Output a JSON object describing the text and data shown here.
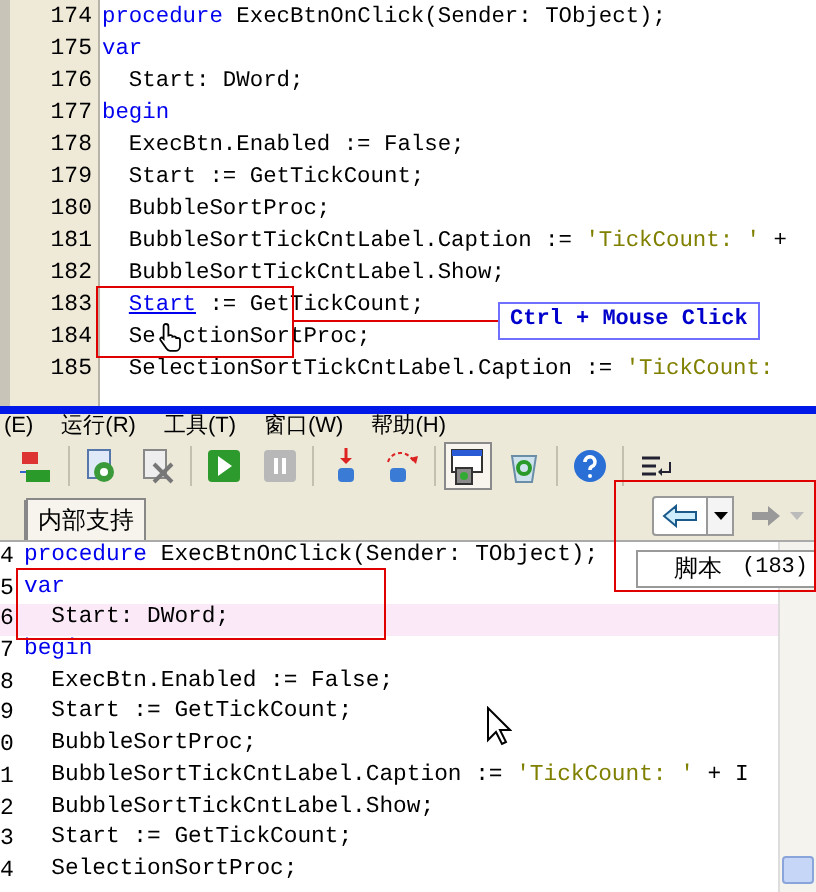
{
  "top_editor": {
    "lines": [
      {
        "number": "174",
        "highlighted": false,
        "tokens": [
          {
            "kind": "keyword",
            "text": "procedure"
          },
          {
            "kind": "plain",
            "text": " ExecBtnOnClick(Sender: TObject);"
          }
        ]
      },
      {
        "number": "175",
        "highlighted": false,
        "tokens": [
          {
            "kind": "keyword",
            "text": "var"
          }
        ]
      },
      {
        "number": "176",
        "highlighted": false,
        "tokens": [
          {
            "kind": "plain",
            "text": "  Start: DWord;"
          }
        ]
      },
      {
        "number": "177",
        "highlighted": false,
        "tokens": [
          {
            "kind": "keyword",
            "text": "begin"
          }
        ]
      },
      {
        "number": "178",
        "highlighted": false,
        "tokens": [
          {
            "kind": "plain",
            "text": "  ExecBtn.Enabled := False;"
          }
        ]
      },
      {
        "number": "179",
        "highlighted": false,
        "tokens": [
          {
            "kind": "plain",
            "text": "  Start := GetTickCount;"
          }
        ]
      },
      {
        "number": "180",
        "highlighted": false,
        "tokens": [
          {
            "kind": "plain",
            "text": "  BubbleSortProc;"
          }
        ]
      },
      {
        "number": "181",
        "highlighted": false,
        "tokens": [
          {
            "kind": "plain",
            "text": "  BubbleSortTickCntLabel.Caption := "
          },
          {
            "kind": "string",
            "text": "'TickCount: '"
          },
          {
            "kind": "plain",
            "text": " +"
          }
        ]
      },
      {
        "number": "182",
        "highlighted": false,
        "tokens": [
          {
            "kind": "plain",
            "text": "  BubbleSortTickCntLabel.Show;"
          }
        ]
      },
      {
        "number": "183",
        "highlighted": false,
        "tokens": [
          {
            "kind": "link",
            "text": "Start"
          },
          {
            "kind": "plain",
            "text": " := GetTickCount;"
          }
        ]
      },
      {
        "number": "184",
        "highlighted": false,
        "tokens": [
          {
            "kind": "plain",
            "text": "  Se"
          },
          {
            "kind": "cursor"
          },
          {
            "kind": "plain",
            "text": "ctionSortProc;"
          }
        ]
      },
      {
        "number": "185",
        "highlighted": false,
        "tokens": [
          {
            "kind": "plain",
            "text": "  SelectionSortTickCntLabel.Caption := "
          },
          {
            "kind": "string",
            "text": "'TickCount:"
          }
        ]
      }
    ],
    "callout": "Ctrl + Mouse Click"
  },
  "menu_bar": [
    "(E)",
    "运行(R)",
    "工具(T)",
    "窗口(W)",
    "帮助(H)"
  ],
  "toolbar": [
    {
      "kind": "replace",
      "pressed": false
    },
    {
      "kind": "doc-gear",
      "pressed": false
    },
    {
      "kind": "doc-x",
      "pressed": false
    },
    {
      "kind": "play",
      "pressed": false
    },
    {
      "kind": "pause",
      "pressed": false
    },
    {
      "kind": "step-into",
      "pressed": false
    },
    {
      "kind": "step-over",
      "pressed": false
    },
    {
      "kind": "window",
      "pressed": true
    },
    {
      "kind": "recycle",
      "pressed": false
    },
    {
      "kind": "help",
      "pressed": false
    },
    {
      "kind": "list",
      "pressed": false
    }
  ],
  "tabs": [
    {
      "label": "内部支持",
      "selected": true
    }
  ],
  "navigation": {
    "back_disabled": false,
    "forward_disabled": true,
    "menu": [
      {
        "label": "脚本",
        "count": "(183)"
      }
    ]
  },
  "bottom_editor": {
    "lines": [
      {
        "number": "4",
        "highlighted": false,
        "tokens": [
          {
            "kind": "keyword",
            "text": "procedure"
          },
          {
            "kind": "plain",
            "text": " ExecBtnOnClick(Sender: TObject);"
          }
        ]
      },
      {
        "number": "5",
        "highlighted": false,
        "tokens": [
          {
            "kind": "keyword",
            "text": "var"
          }
        ]
      },
      {
        "number": "6",
        "highlighted": true,
        "tokens": [
          {
            "kind": "plain",
            "text": "  Start: DWord;"
          }
        ]
      },
      {
        "number": "7",
        "highlighted": false,
        "tokens": [
          {
            "kind": "keyword",
            "text": "begin"
          }
        ]
      },
      {
        "number": "8",
        "highlighted": false,
        "tokens": [
          {
            "kind": "plain",
            "text": "  ExecBtn.Enabled := False;"
          }
        ]
      },
      {
        "number": "9",
        "highlighted": false,
        "tokens": [
          {
            "kind": "plain",
            "text": "  Start := GetTickCount;"
          }
        ]
      },
      {
        "number": "0",
        "highlighted": false,
        "tokens": [
          {
            "kind": "plain",
            "text": "  BubbleSortProc;"
          }
        ]
      },
      {
        "number": "1",
        "highlighted": false,
        "tokens": [
          {
            "kind": "plain",
            "text": "  BubbleSortTickCntLabel.Caption := "
          },
          {
            "kind": "string",
            "text": "'TickCount: '"
          },
          {
            "kind": "plain",
            "text": " + I"
          }
        ]
      },
      {
        "number": "2",
        "highlighted": false,
        "tokens": [
          {
            "kind": "plain",
            "text": "  BubbleSortTickCntLabel.Show;"
          }
        ]
      },
      {
        "number": "3",
        "highlighted": false,
        "tokens": [
          {
            "kind": "plain",
            "text": "  Start := GetTickCount;"
          }
        ]
      },
      {
        "number": "4",
        "highlighted": false,
        "tokens": [
          {
            "kind": "plain",
            "text": "  SelectionSortProc;"
          }
        ]
      }
    ]
  }
}
